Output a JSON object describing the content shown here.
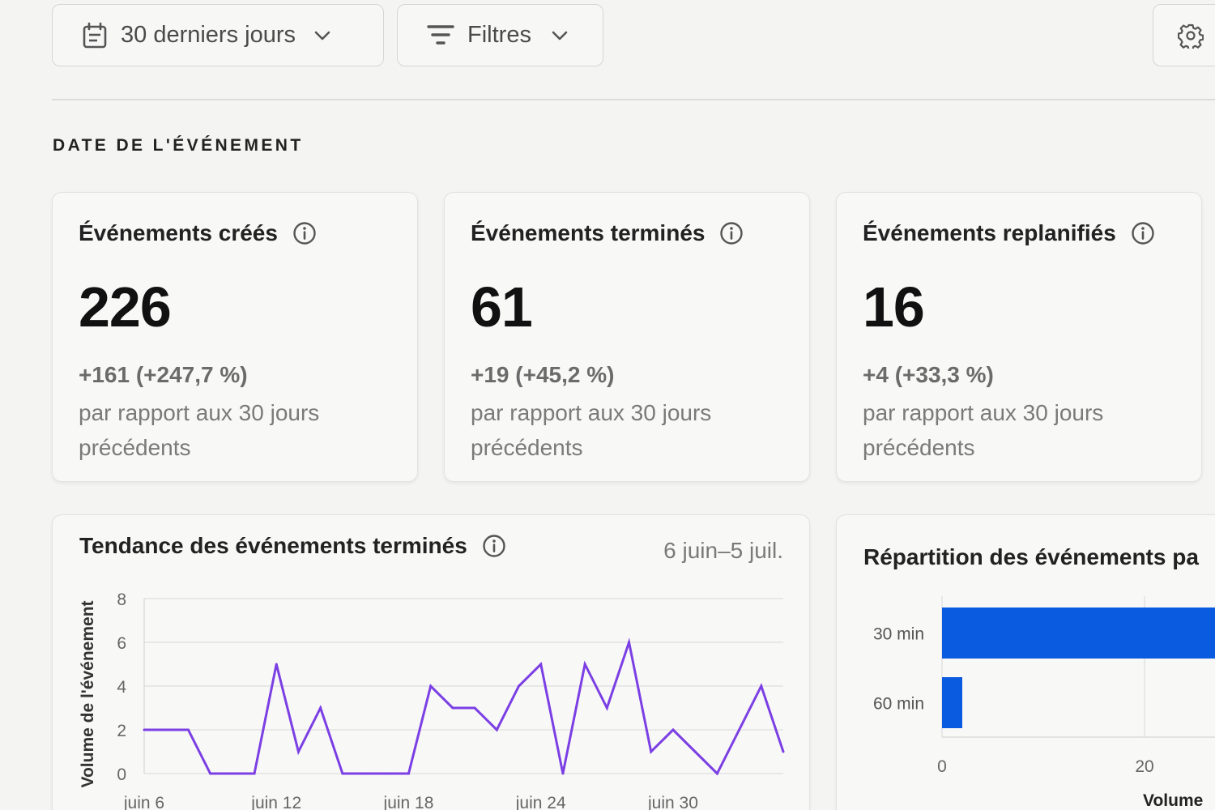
{
  "toolbar": {
    "range_label": "30 derniers jours",
    "filter_label": "Filtres"
  },
  "section": {
    "title": "DATE DE L'ÉVÉNEMENT"
  },
  "kpis": [
    {
      "title": "Événements créés",
      "value": "226",
      "delta": "+161 (+247,7 %)",
      "comparison": "par rapport aux 30 jours précédents"
    },
    {
      "title": "Événements terminés",
      "value": "61",
      "delta": "+19 (+45,2 %)",
      "comparison": "par rapport aux 30 jours précédents"
    },
    {
      "title": "Événements replanifiés",
      "value": "16",
      "delta": "+4 (+33,3 %)",
      "comparison": "par rapport aux 30 jours précédents"
    }
  ],
  "trend": {
    "title": "Tendance des événements terminés",
    "date_range": "6 juin–5 juil."
  },
  "breakdown": {
    "title": "Répartition des événements pa"
  },
  "colors": {
    "line": "#7b3fe4",
    "bar": "#0b5be0"
  },
  "chart_data": [
    {
      "type": "line",
      "title": "Tendance des événements terminés",
      "xlabel": "",
      "ylabel": "Volume de l'événement",
      "ylim": [
        0,
        8
      ],
      "yticks": [
        0,
        2,
        4,
        6,
        8
      ],
      "xtick_labels": [
        "juin 6",
        "juin 12",
        "juin 18",
        "juin 24",
        "juin 30"
      ],
      "x": [
        "juin 6",
        "juin 7",
        "juin 8",
        "juin 9",
        "juin 10",
        "juin 11",
        "juin 12",
        "juin 13",
        "juin 14",
        "juin 15",
        "juin 16",
        "juin 17",
        "juin 18",
        "juin 19",
        "juin 20",
        "juin 21",
        "juin 22",
        "juin 23",
        "juin 24",
        "juin 25",
        "juin 26",
        "juin 27",
        "juin 28",
        "juin 29",
        "juin 30",
        "juil. 1",
        "juil. 2",
        "juil. 3",
        "juil. 4",
        "juil. 5"
      ],
      "series": [
        {
          "values": [
            2,
            2,
            2,
            0,
            0,
            0,
            5,
            1,
            3,
            0,
            0,
            0,
            0,
            4,
            3,
            3,
            2,
            4,
            5,
            0,
            5,
            3,
            6,
            1,
            2,
            1,
            0,
            2,
            4,
            1
          ]
        }
      ],
      "grid": true
    },
    {
      "type": "bar",
      "orientation": "horizontal",
      "title": "Répartition des événements pa",
      "xlabel": "Volume",
      "categories": [
        "30 min",
        "60 min"
      ],
      "values": [
        59,
        2
      ],
      "xticks": [
        0,
        20
      ],
      "xlim": [
        0,
        60
      ],
      "grid": true
    }
  ]
}
